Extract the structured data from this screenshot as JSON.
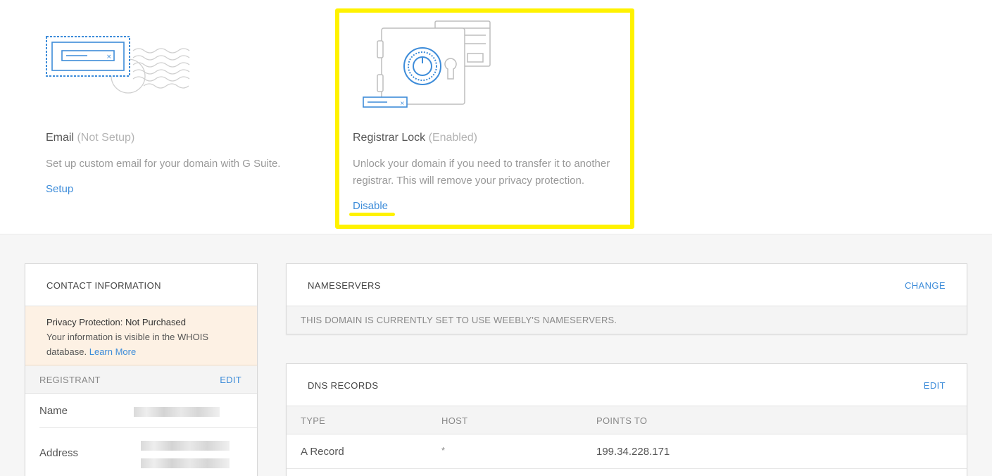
{
  "features": {
    "email": {
      "title": "Email",
      "status": "(Not Setup)",
      "description": "Set up custom email for your domain with G Suite.",
      "link": "Setup",
      "icon": "stamp-envelope-icon"
    },
    "registrar_lock": {
      "title": "Registrar Lock",
      "status": "(Enabled)",
      "description_line1": "Unlock your domain if you need to transfer it to another",
      "description_line2": "registrar. This will remove your privacy protection.",
      "link": "Disable",
      "icon": "safe-vault-icon"
    }
  },
  "contact": {
    "title": "CONTACT INFORMATION",
    "privacy_title": "Privacy Protection: Not Purchased",
    "privacy_text_line1": "Your information is visible in the WHOIS",
    "privacy_text_line2": "database.",
    "learn_more": "Learn More",
    "registrant_label": "REGISTRANT",
    "edit_label": "EDIT",
    "name_label": "Name",
    "address_label": "Address"
  },
  "nameservers": {
    "title": "NAMESERVERS",
    "action": "CHANGE",
    "note": "THIS DOMAIN IS CURRENTLY SET TO USE WEEBLY'S NAMESERVERS."
  },
  "dns": {
    "title": "DNS RECORDS",
    "action": "EDIT",
    "columns": [
      "TYPE",
      "HOST",
      "POINTS TO"
    ],
    "rows": [
      {
        "type": "A Record",
        "host": "*",
        "points_to": "199.34.228.171"
      }
    ]
  },
  "colors": {
    "accent": "#3d8cd9",
    "highlight": "#fff200",
    "privacy_bg": "#fdf1e4"
  }
}
